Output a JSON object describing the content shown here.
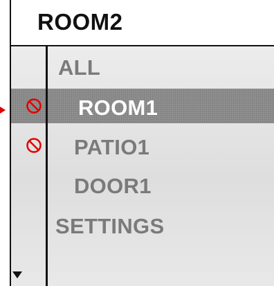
{
  "header": {
    "title": "ROOM2"
  },
  "menu": {
    "items": [
      {
        "label": "ALL",
        "selected": false,
        "blocked": false
      },
      {
        "label": "ROOM1",
        "selected": true,
        "blocked": true
      },
      {
        "label": "PATIO1",
        "selected": false,
        "blocked": true
      },
      {
        "label": "DOOR1",
        "selected": false,
        "blocked": false
      },
      {
        "label": "SETTINGS",
        "selected": false,
        "blocked": false
      }
    ]
  },
  "icons": {
    "blocked": "no-entry-icon",
    "scroll": "triangle-down-icon",
    "pointer": "pointer-arrow-icon"
  },
  "colors": {
    "blocked_icon": "#e00000",
    "selected_row": "#8a8a8a",
    "selected_text": "#ffffff",
    "item_text": "#7a7a7a"
  }
}
